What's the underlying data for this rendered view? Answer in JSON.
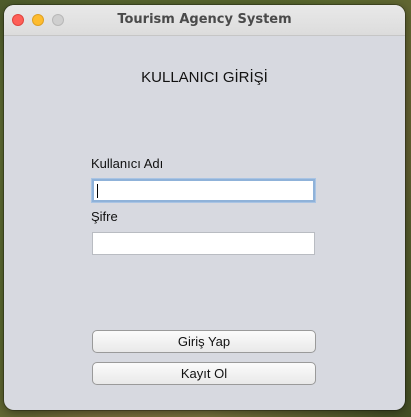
{
  "window": {
    "title": "Tourism Agency System"
  },
  "login": {
    "heading": "KULLANICI GİRİŞİ",
    "username_label": "Kullanıcı Adı",
    "username_value": "",
    "password_label": "Şifre",
    "password_value": "",
    "login_button": "Giriş Yap",
    "register_button": "Kayıt Ol"
  },
  "colors": {
    "close": "#fe5f57",
    "minimize": "#febc2e",
    "focus_ring": "#8fb2d9",
    "window_bg": "#d7d9e0"
  }
}
